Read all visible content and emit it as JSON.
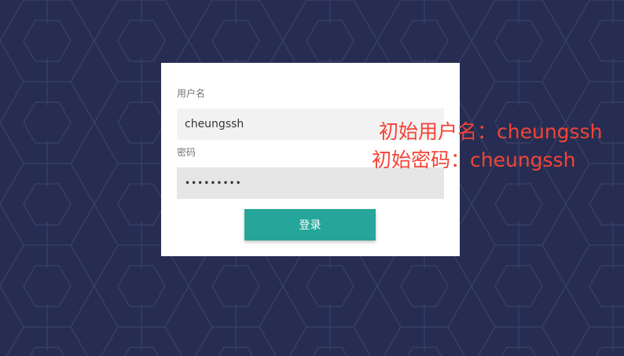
{
  "colors": {
    "background": "#272d52",
    "card": "#ffffff",
    "accent_button": "#26a69a",
    "annotation_text": "#f44336"
  },
  "login_form": {
    "username_label": "用户名",
    "username_value": "cheungssh",
    "password_label": "密码",
    "password_value": "•••••••••",
    "login_button_label": "登录"
  },
  "annotations": {
    "initial_username": "初始用户名：cheungssh",
    "initial_password": "初始密码：cheungssh"
  }
}
